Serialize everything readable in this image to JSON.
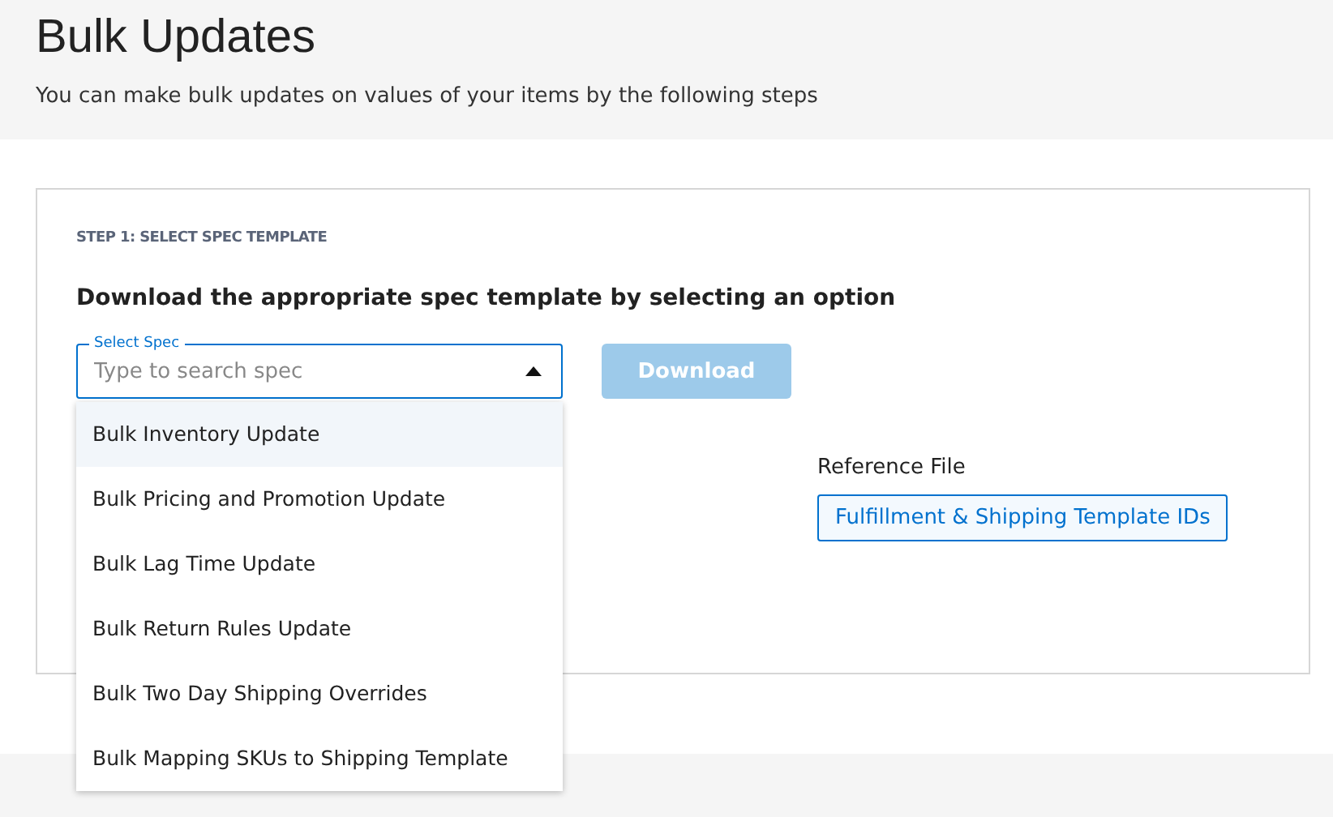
{
  "header": {
    "title": "Bulk Updates",
    "subtitle": "You can make bulk updates on values of your items by the following steps"
  },
  "step": {
    "label": "STEP 1: SELECT SPEC TEMPLATE",
    "heading": "Download the appropriate spec template by selecting an option",
    "select": {
      "label": "Select Spec",
      "placeholder": "Type to search spec",
      "expanded": true,
      "options": [
        {
          "label": "Bulk Inventory Update",
          "selected": true
        },
        {
          "label": "Bulk Pricing and Promotion Update",
          "selected": false
        },
        {
          "label": "Bulk Lag Time Update",
          "selected": false
        },
        {
          "label": "Bulk Return Rules Update",
          "selected": false
        },
        {
          "label": "Bulk Two Day Shipping Overrides",
          "selected": false
        },
        {
          "label": "Bulk Mapping SKUs to Shipping Template",
          "selected": false
        }
      ]
    },
    "download": {
      "label": "Download",
      "disabled": true
    },
    "reference": {
      "label": "Reference File",
      "link": "Fulfillment & Shipping Template IDs"
    }
  }
}
